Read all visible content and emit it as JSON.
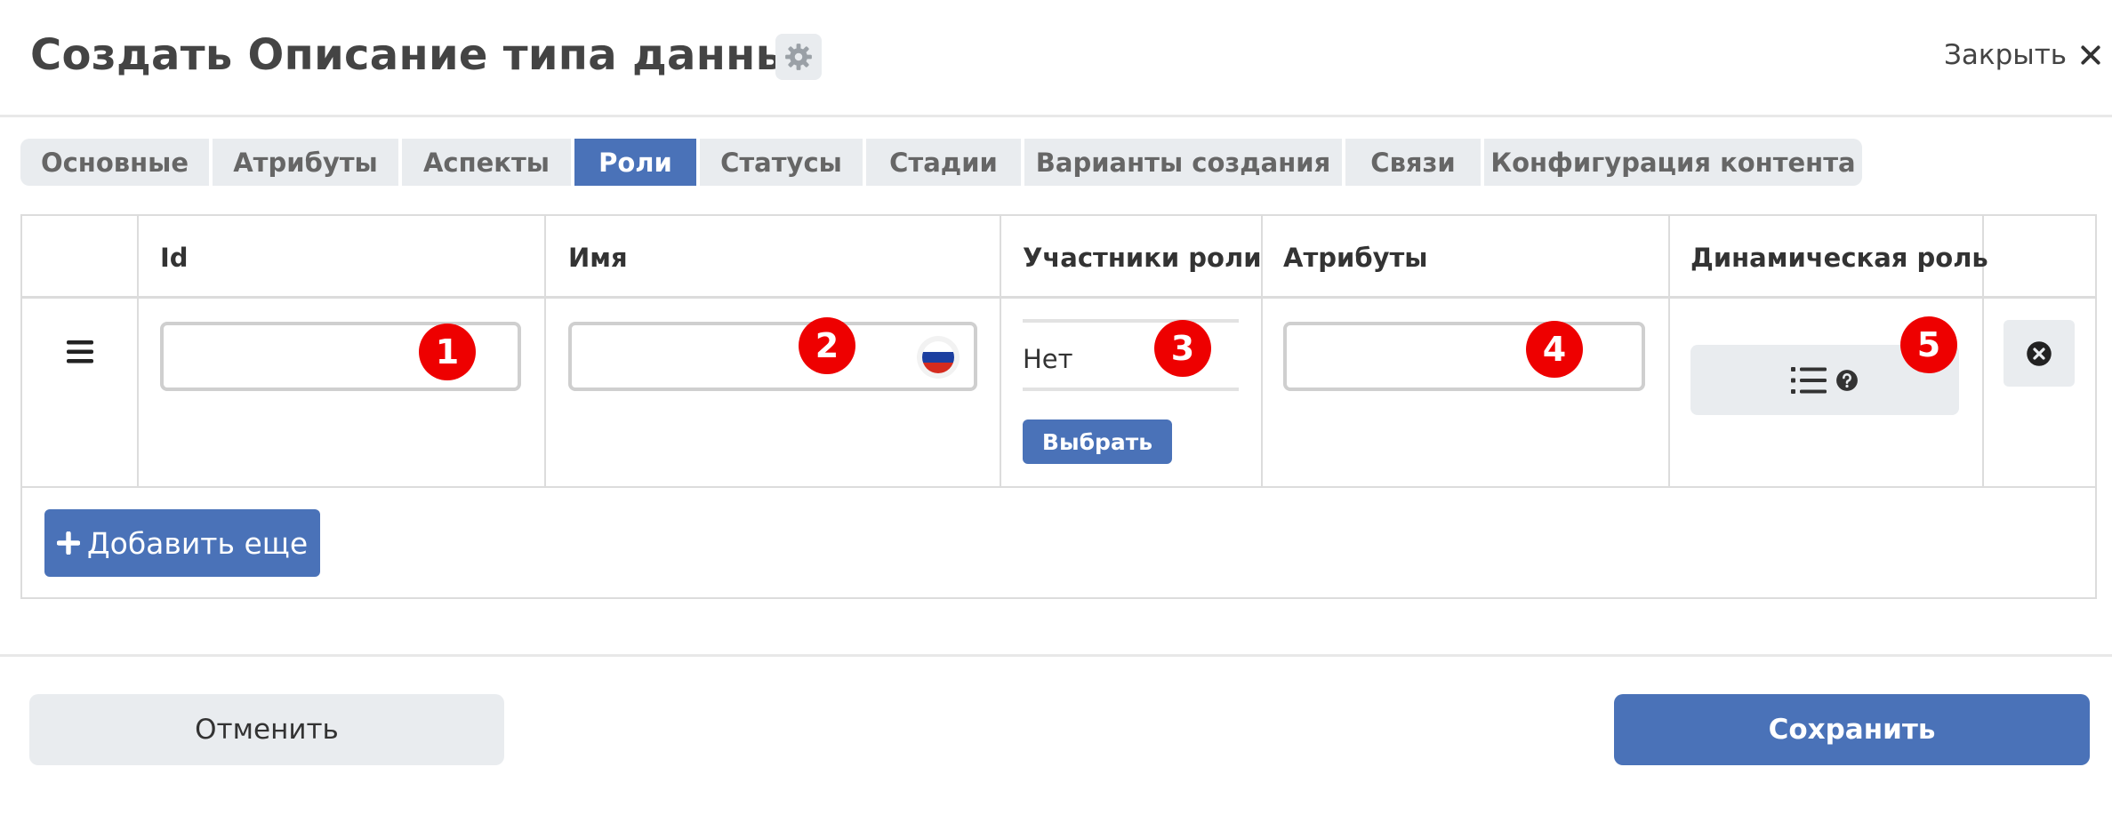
{
  "header": {
    "title": "Создать Описание типа данных",
    "close_label": "Закрыть"
  },
  "tabs": [
    {
      "label": "Основные",
      "active": false
    },
    {
      "label": "Атрибуты",
      "active": false
    },
    {
      "label": "Аспекты",
      "active": false
    },
    {
      "label": "Роли",
      "active": true
    },
    {
      "label": "Статусы",
      "active": false
    },
    {
      "label": "Стадии",
      "active": false
    },
    {
      "label": "Варианты создания",
      "active": false
    },
    {
      "label": "Связи",
      "active": false
    },
    {
      "label": "Конфигурация контента",
      "active": false
    }
  ],
  "table": {
    "columns": [
      "Id",
      "Имя",
      "Участники роли",
      "Атрибуты",
      "Динамическая роль"
    ],
    "row": {
      "id_value": "",
      "name_value": "",
      "participants_value": "Нет",
      "choose_label": "Выбрать",
      "attributes_value": ""
    },
    "add_more_label": "Добавить еще"
  },
  "annotations": [
    "1",
    "2",
    "3",
    "4",
    "5"
  ],
  "footer": {
    "cancel_label": "Отменить",
    "save_label": "Сохранить"
  },
  "icons": {
    "settings": "gear-icon",
    "close": "close-icon",
    "drag": "drag-handle-icon",
    "flag": "russian-flag-icon",
    "list": "list-icon",
    "help": "question-circle-icon",
    "remove": "times-circle-icon",
    "add": "plus-icon"
  },
  "colors": {
    "accent": "#4a72b8",
    "badge": "#ee0000",
    "tab_bg": "#e9ecef"
  }
}
